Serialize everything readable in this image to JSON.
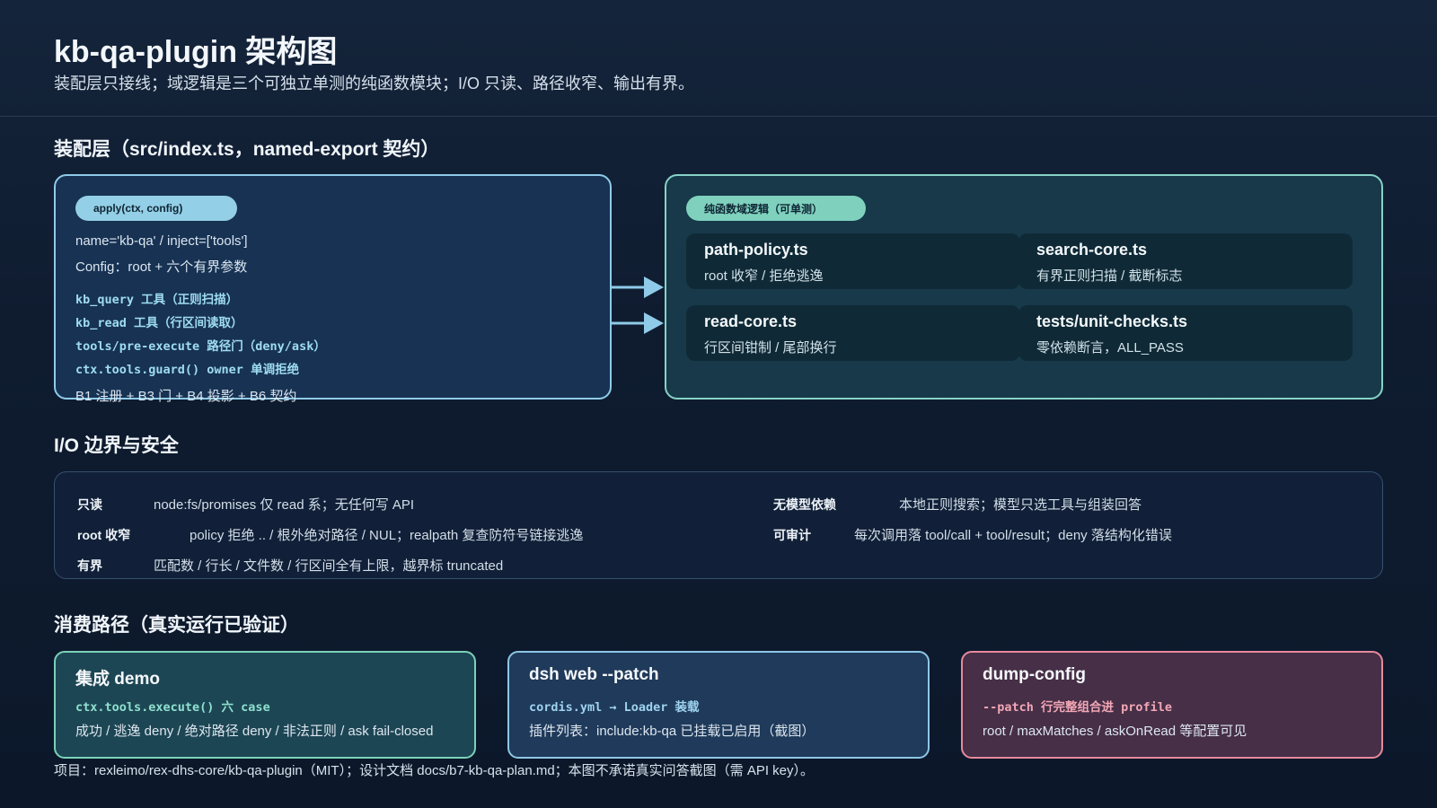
{
  "title": "kb-qa-plugin 架构图",
  "subtitle": "装配层只接线；域逻辑是三个可独立单测的纯函数模块；I/O 只读、路径收窄、输出有界。",
  "sections": {
    "assembly": "装配层（src/index.ts，named-export 契约）",
    "io": "I/O 边界与安全",
    "consumption": "消费路径（真实运行已验证）"
  },
  "assembly_panel": {
    "pill": "apply(ctx, config)",
    "lines": [
      "name='kb-qa' / inject=['tools']",
      "Config：root + 六个有界参数"
    ],
    "code_lines": [
      "kb_query 工具（正则扫描）",
      "kb_read 工具（行区间读取）",
      "tools/pre-execute 路径门（deny/ask）",
      "ctx.tools.guard() owner 单调拒绝"
    ],
    "footer": "B1 注册 + B3 门 + B4 投影 + B6 契约"
  },
  "domain_panel": {
    "pill": "纯函数域逻辑（可单测）",
    "modules": [
      {
        "name": "path-policy.ts",
        "desc": "root 收窄 / 拒绝逃逸"
      },
      {
        "name": "search-core.ts",
        "desc": "有界正则扫描 / 截断标志"
      },
      {
        "name": "read-core.ts",
        "desc": "行区间钳制 / 尾部换行"
      },
      {
        "name": "tests/unit-checks.ts",
        "desc": "零依赖断言，ALL_PASS"
      }
    ]
  },
  "io_rows": [
    {
      "label": "只读",
      "value": "node:fs/promises 仅 read 系；无任何写 API"
    },
    {
      "label": "root 收窄",
      "value": "policy 拒绝 .. / 根外绝对路径 / NUL；realpath 复查防符号链接逃逸"
    },
    {
      "label": "有界",
      "value": "匹配数 / 行长 / 文件数 / 行区间全有上限，越界标 truncated"
    },
    {
      "label": "无模型依赖",
      "value": "本地正则搜索；模型只选工具与组装回答"
    },
    {
      "label": "可审计",
      "value": "每次调用落 tool/call + tool/result；deny 落结构化错误"
    }
  ],
  "cards": [
    {
      "title": "集成 demo",
      "code": "ctx.tools.execute() 六 case",
      "desc": "成功 / 逃逸 deny / 绝对路径 deny / 非法正则 / ask fail-closed"
    },
    {
      "title": "dsh web --patch",
      "code": "cordis.yml → Loader 装载",
      "desc": "插件列表：include:kb-qa 已挂载已启用（截图）"
    },
    {
      "title": "dump-config",
      "code": "--patch 行完整组合进 profile",
      "desc": "root / maxMatches / askOnRead 等配置可见"
    }
  ],
  "footer": "项目：rexleimo/rex-dhs-core/kb-qa-plugin（MIT）；设计文档 docs/b7-kb-qa-plan.md；本图不承诺真实问答截图（需 API key）。",
  "colors": {
    "assembly_border": "#8fcbe9",
    "domain_border": "#86d3c6",
    "arrow": "#8fcbe9",
    "card_demo_border": "#7bd2b8",
    "card_web_border": "#8ec6e6",
    "card_dump_border": "#e88a9c"
  }
}
